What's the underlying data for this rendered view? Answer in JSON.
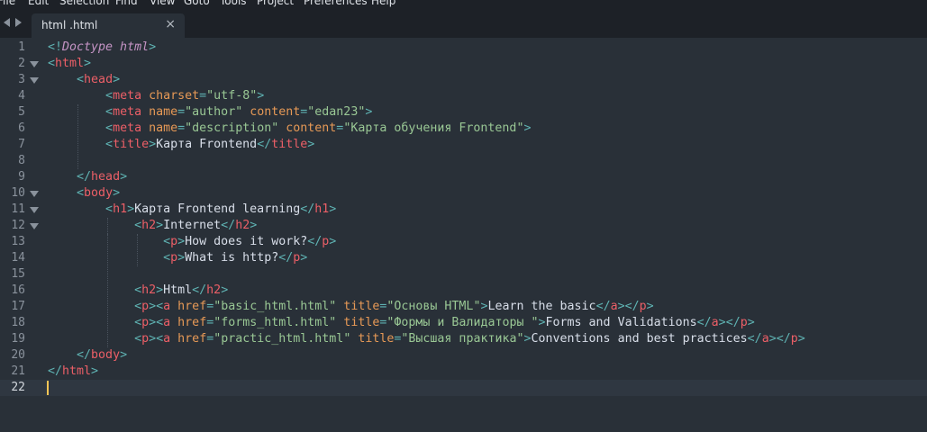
{
  "menu": [
    "File",
    "Edit",
    "Selection",
    "Find",
    "View",
    "Goto",
    "Tools",
    "Project",
    "Preferences",
    "Help"
  ],
  "tab": {
    "label": "html .html",
    "close": "×"
  },
  "colors": {
    "background": "#293038",
    "tag": "#ec5f67",
    "punctuation": "#5fb3b3",
    "attribute": "#e69956",
    "string": "#99c794",
    "text": "#d8dee9",
    "doctype": "#c594c5"
  },
  "current_line": 22,
  "lines": [
    {
      "n": "1",
      "fold": false,
      "tokens": [
        [
          "pun",
          "<!"
        ],
        [
          "dt",
          "Doctype html"
        ],
        [
          "pun",
          ">"
        ]
      ]
    },
    {
      "n": "2",
      "fold": true,
      "tokens": [
        [
          "pun",
          "<"
        ],
        [
          "tag",
          "html"
        ],
        [
          "pun",
          ">"
        ]
      ]
    },
    {
      "n": "3",
      "fold": true,
      "tokens": [
        [
          "txt",
          "    "
        ],
        [
          "pun",
          "<"
        ],
        [
          "tag",
          "head"
        ],
        [
          "pun",
          ">"
        ]
      ]
    },
    {
      "n": "4",
      "fold": false,
      "tokens": [
        [
          "txt",
          "        "
        ],
        [
          "pun",
          "<"
        ],
        [
          "tag",
          "meta"
        ],
        [
          "txt",
          " "
        ],
        [
          "atn",
          "charset"
        ],
        [
          "pun",
          "="
        ],
        [
          "str",
          "\"utf-8\""
        ],
        [
          "pun",
          ">"
        ]
      ]
    },
    {
      "n": "5",
      "fold": false,
      "tokens": [
        [
          "txt",
          "        "
        ],
        [
          "pun",
          "<"
        ],
        [
          "tag",
          "meta"
        ],
        [
          "txt",
          " "
        ],
        [
          "atn",
          "name"
        ],
        [
          "pun",
          "="
        ],
        [
          "str",
          "\"author\""
        ],
        [
          "txt",
          " "
        ],
        [
          "atn",
          "content"
        ],
        [
          "pun",
          "="
        ],
        [
          "str",
          "\"edan23\""
        ],
        [
          "pun",
          ">"
        ]
      ]
    },
    {
      "n": "6",
      "fold": false,
      "tokens": [
        [
          "txt",
          "        "
        ],
        [
          "pun",
          "<"
        ],
        [
          "tag",
          "meta"
        ],
        [
          "txt",
          " "
        ],
        [
          "atn",
          "name"
        ],
        [
          "pun",
          "="
        ],
        [
          "str",
          "\"description\""
        ],
        [
          "txt",
          " "
        ],
        [
          "atn",
          "content"
        ],
        [
          "pun",
          "="
        ],
        [
          "str",
          "\"Карта обучения Frontend\""
        ],
        [
          "pun",
          ">"
        ]
      ]
    },
    {
      "n": "7",
      "fold": false,
      "tokens": [
        [
          "txt",
          "        "
        ],
        [
          "pun",
          "<"
        ],
        [
          "tag",
          "title"
        ],
        [
          "pun",
          ">"
        ],
        [
          "txt",
          "Карта Frontend"
        ],
        [
          "pun",
          "</"
        ],
        [
          "tag",
          "title"
        ],
        [
          "pun",
          ">"
        ]
      ]
    },
    {
      "n": "8",
      "fold": false,
      "tokens": []
    },
    {
      "n": "9",
      "fold": false,
      "tokens": [
        [
          "txt",
          "    "
        ],
        [
          "pun",
          "</"
        ],
        [
          "tag",
          "head"
        ],
        [
          "pun",
          ">"
        ]
      ]
    },
    {
      "n": "10",
      "fold": true,
      "tokens": [
        [
          "txt",
          "    "
        ],
        [
          "pun",
          "<"
        ],
        [
          "tag",
          "body"
        ],
        [
          "pun",
          ">"
        ]
      ]
    },
    {
      "n": "11",
      "fold": true,
      "tokens": [
        [
          "txt",
          "        "
        ],
        [
          "pun",
          "<"
        ],
        [
          "tag",
          "h1"
        ],
        [
          "pun",
          ">"
        ],
        [
          "txt",
          "Карта Frontend learning"
        ],
        [
          "pun",
          "</"
        ],
        [
          "tag",
          "h1"
        ],
        [
          "pun",
          ">"
        ]
      ]
    },
    {
      "n": "12",
      "fold": true,
      "tokens": [
        [
          "txt",
          "            "
        ],
        [
          "pun",
          "<"
        ],
        [
          "tag",
          "h2"
        ],
        [
          "pun",
          ">"
        ],
        [
          "txt",
          "Internet"
        ],
        [
          "pun",
          "</"
        ],
        [
          "tag",
          "h2"
        ],
        [
          "pun",
          ">"
        ]
      ]
    },
    {
      "n": "13",
      "fold": false,
      "tokens": [
        [
          "txt",
          "                "
        ],
        [
          "pun",
          "<"
        ],
        [
          "tag",
          "p"
        ],
        [
          "pun",
          ">"
        ],
        [
          "txt",
          "How does it work?"
        ],
        [
          "pun",
          "</"
        ],
        [
          "tag",
          "p"
        ],
        [
          "pun",
          ">"
        ]
      ]
    },
    {
      "n": "14",
      "fold": false,
      "tokens": [
        [
          "txt",
          "                "
        ],
        [
          "pun",
          "<"
        ],
        [
          "tag",
          "p"
        ],
        [
          "pun",
          ">"
        ],
        [
          "txt",
          "What is http?"
        ],
        [
          "pun",
          "</"
        ],
        [
          "tag",
          "p"
        ],
        [
          "pun",
          ">"
        ]
      ]
    },
    {
      "n": "15",
      "fold": false,
      "tokens": []
    },
    {
      "n": "16",
      "fold": false,
      "tokens": [
        [
          "txt",
          "            "
        ],
        [
          "pun",
          "<"
        ],
        [
          "tag",
          "h2"
        ],
        [
          "pun",
          ">"
        ],
        [
          "txt",
          "Html"
        ],
        [
          "pun",
          "</"
        ],
        [
          "tag",
          "h2"
        ],
        [
          "pun",
          ">"
        ]
      ]
    },
    {
      "n": "17",
      "fold": false,
      "tokens": [
        [
          "txt",
          "            "
        ],
        [
          "pun",
          "<"
        ],
        [
          "tag",
          "p"
        ],
        [
          "pun",
          ">"
        ],
        [
          "pun",
          "<"
        ],
        [
          "tag",
          "a"
        ],
        [
          "txt",
          " "
        ],
        [
          "atn",
          "href"
        ],
        [
          "pun",
          "="
        ],
        [
          "str",
          "\"basic_html.html\""
        ],
        [
          "txt",
          " "
        ],
        [
          "atn",
          "title"
        ],
        [
          "pun",
          "="
        ],
        [
          "str",
          "\"Основы HTML\""
        ],
        [
          "pun",
          ">"
        ],
        [
          "txt",
          "Learn the basic"
        ],
        [
          "pun",
          "</"
        ],
        [
          "tag",
          "a"
        ],
        [
          "pun",
          ">"
        ],
        [
          "pun",
          "</"
        ],
        [
          "tag",
          "p"
        ],
        [
          "pun",
          ">"
        ]
      ]
    },
    {
      "n": "18",
      "fold": false,
      "tokens": [
        [
          "txt",
          "            "
        ],
        [
          "pun",
          "<"
        ],
        [
          "tag",
          "p"
        ],
        [
          "pun",
          ">"
        ],
        [
          "pun",
          "<"
        ],
        [
          "tag",
          "a"
        ],
        [
          "txt",
          " "
        ],
        [
          "atn",
          "href"
        ],
        [
          "pun",
          "="
        ],
        [
          "str",
          "\"forms_html.html\""
        ],
        [
          "txt",
          " "
        ],
        [
          "atn",
          "title"
        ],
        [
          "pun",
          "="
        ],
        [
          "str",
          "\"Формы и Валидаторы \""
        ],
        [
          "pun",
          ">"
        ],
        [
          "txt",
          "Forms and Validations"
        ],
        [
          "pun",
          "</"
        ],
        [
          "tag",
          "a"
        ],
        [
          "pun",
          ">"
        ],
        [
          "pun",
          "</"
        ],
        [
          "tag",
          "p"
        ],
        [
          "pun",
          ">"
        ]
      ]
    },
    {
      "n": "19",
      "fold": false,
      "tokens": [
        [
          "txt",
          "            "
        ],
        [
          "pun",
          "<"
        ],
        [
          "tag",
          "p"
        ],
        [
          "pun",
          ">"
        ],
        [
          "pun",
          "<"
        ],
        [
          "tag",
          "a"
        ],
        [
          "txt",
          " "
        ],
        [
          "atn",
          "href"
        ],
        [
          "pun",
          "="
        ],
        [
          "str",
          "\"practic_html.html\""
        ],
        [
          "txt",
          " "
        ],
        [
          "atn",
          "title"
        ],
        [
          "pun",
          "="
        ],
        [
          "str",
          "\"Высшая практика\""
        ],
        [
          "pun",
          ">"
        ],
        [
          "txt",
          "Conventions and best practices"
        ],
        [
          "pun",
          "</"
        ],
        [
          "tag",
          "a"
        ],
        [
          "pun",
          ">"
        ],
        [
          "pun",
          "</"
        ],
        [
          "tag",
          "p"
        ],
        [
          "pun",
          ">"
        ]
      ]
    },
    {
      "n": "20",
      "fold": false,
      "tokens": [
        [
          "txt",
          "    "
        ],
        [
          "pun",
          "</"
        ],
        [
          "tag",
          "body"
        ],
        [
          "pun",
          ">"
        ]
      ]
    },
    {
      "n": "21",
      "fold": false,
      "tokens": [
        [
          "pun",
          "</"
        ],
        [
          "tag",
          "html"
        ],
        [
          "pun",
          ">"
        ]
      ]
    },
    {
      "n": "22",
      "fold": false,
      "tokens": []
    }
  ]
}
